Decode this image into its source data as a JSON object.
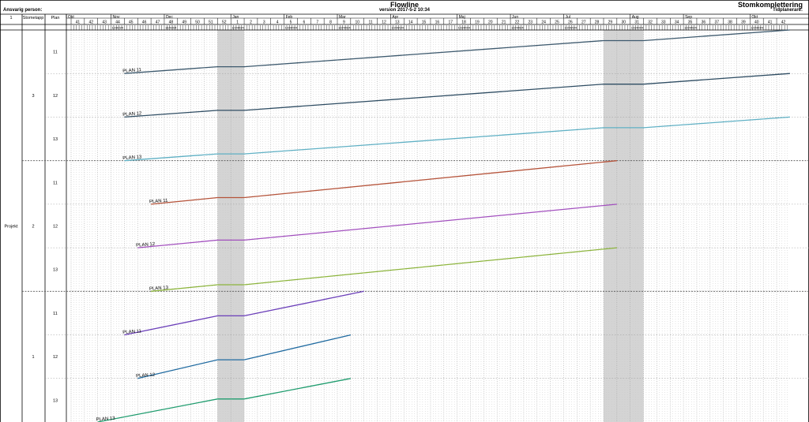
{
  "header": {
    "title": "Flowline",
    "version": "version 2017-5-2 10:34",
    "responsible_label": "Ansvarig person:",
    "project_name": "Stomkomplettering",
    "planners_label": "Tidplanerare:"
  },
  "colors": {
    "nonwork": "#d4d4d4",
    "section_divider": "#555555",
    "grid_dots": "#c8c8c8"
  },
  "chart_data": {
    "type": "line",
    "subtype": "flowline-schedule",
    "columns": [
      "1",
      "Stometapp",
      "Plan"
    ],
    "months": [
      "Okt",
      "Nov",
      "Dec",
      "Jan",
      "Feb",
      "Mar",
      "Apr",
      "Maj",
      "Jun",
      "Jul",
      "Aug",
      "Sep",
      "Okt"
    ],
    "week_range": {
      "from": 41,
      "to": 42,
      "year_break_after": 52
    },
    "date_labels": [
      "12/4/0/4",
      "12/4/0/4",
      "1/2/4/0/4",
      "1/2/4/0/4",
      "1/2/4/0/4",
      "1/2/4/0/4",
      "1/2/4/0/4",
      "1/2/4/0/4",
      "1/2/4/0/4",
      "1/2/4/0/4",
      "1/2/4/0/4",
      "1/2/4/0/4"
    ],
    "nonwork_weeks": [
      [
        52,
        1
      ],
      [
        29,
        31
      ]
    ],
    "project_label": "Projekt",
    "stages": [
      {
        "id": "3",
        "plans": [
          "11",
          "12",
          "13"
        ]
      },
      {
        "id": "2",
        "plans": [
          "11",
          "12",
          "13"
        ]
      },
      {
        "id": "1",
        "plans": [
          "11",
          "12",
          "13"
        ]
      }
    ],
    "series": [
      {
        "name": "PLAN 11",
        "stage": "3",
        "plan": "11",
        "color": "#3e5a6e",
        "start_week": 45,
        "end_week": 42,
        "start_level": 0.0,
        "end_level": 1.0,
        "start_date": "2016-11-07",
        "end_date": "2017-10-20"
      },
      {
        "name": "PLAN 12",
        "stage": "3",
        "plan": "12",
        "color": "#2f4d63",
        "start_week": 45,
        "end_week": 42,
        "start_level": 0.0,
        "end_level": 1.0,
        "start_date": "2016-11-07",
        "end_date": "2017-10-20"
      },
      {
        "name": "PLAN 13",
        "stage": "3",
        "plan": "13",
        "color": "#5fb0c4",
        "start_week": 45,
        "end_week": 42,
        "start_level": 0.0,
        "end_level": 1.0,
        "start_date": "2016-11-07",
        "end_date": "2017-10-20"
      },
      {
        "name": "PLAN 11",
        "stage": "2",
        "plan": "11",
        "color": "#b5533a",
        "start_week": 47,
        "end_week": 29,
        "start_level": 0.0,
        "end_level": 1.0,
        "start_date": "2016-11-21",
        "end_date": "2017-07-17"
      },
      {
        "name": "PLAN 12",
        "stage": "2",
        "plan": "12",
        "color": "#a24fbe",
        "start_week": 46,
        "end_week": 29,
        "start_level": 0.0,
        "end_level": 1.0,
        "start_date": "2016-11-14",
        "end_date": "2017-07-17"
      },
      {
        "name": "PLAN 13",
        "stage": "2",
        "plan": "13",
        "color": "#8cb43c",
        "start_week": 47,
        "end_week": 29,
        "start_level": 0.0,
        "end_level": 1.0,
        "start_date": "2016-11-21",
        "end_date": "2017-07-17"
      },
      {
        "name": "PLAN 11",
        "stage": "1",
        "plan": "11",
        "color": "#6b3fb9",
        "start_week": 45,
        "end_week": 10,
        "start_level": 0.0,
        "end_level": 1.0,
        "start_date": "2016-11-07",
        "end_date": "2017-03-10"
      },
      {
        "name": "PLAN 12",
        "stage": "1",
        "plan": "12",
        "color": "#1f6aa0",
        "start_week": 46,
        "end_week": 9,
        "start_level": 0.0,
        "end_level": 1.0,
        "start_date": "2016-11-14",
        "end_date": "2017-03-03"
      },
      {
        "name": "PLAN 13",
        "stage": "1",
        "plan": "13",
        "color": "#1f9c6e",
        "start_week": 43,
        "end_week": 9,
        "start_level": 0.0,
        "end_level": 1.0,
        "start_date": "2016-10-24",
        "end_date": "2017-03-03"
      }
    ]
  }
}
